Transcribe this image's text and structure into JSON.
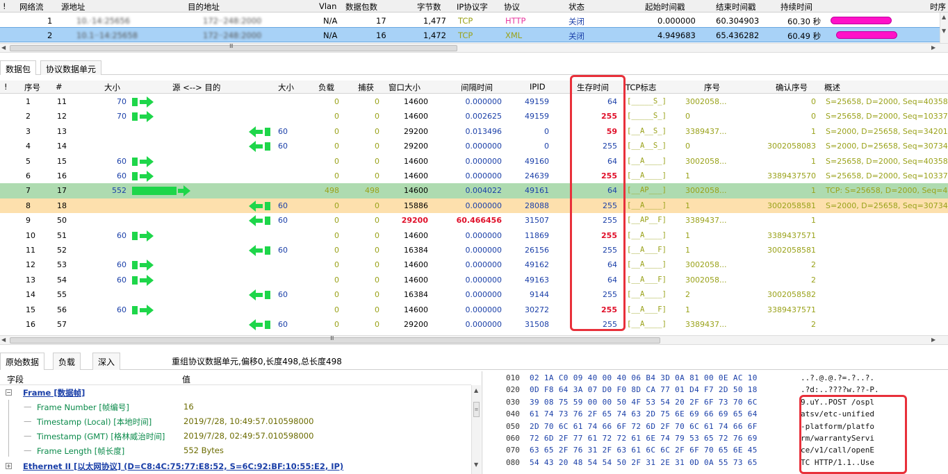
{
  "flows": {
    "columns": [
      "!",
      "网络流",
      "源地址",
      "目的地址",
      "Vlan",
      "数据包数",
      "字节数",
      "IP协议字",
      "协议",
      "状态",
      "起始时间戳",
      "结束时间戳",
      "持续时间",
      "时序"
    ],
    "rows": [
      {
        "idx": "1",
        "src": "10.·14:25656",
        "dst": "172··248:2000",
        "vlan": "N/A",
        "packets": "17",
        "bytes": "1,477",
        "ip_proto": "TCP",
        "proto": "HTTP",
        "state": "关闭",
        "start": "0.000000",
        "end": "60.304903",
        "duration": "60.30 秒"
      },
      {
        "idx": "2",
        "src": "10.1··14:25658",
        "dst": "172··248:2000",
        "vlan": "N/A",
        "packets": "16",
        "bytes": "1,472",
        "ip_proto": "TCP",
        "proto": "XML",
        "state": "关闭",
        "start": "4.949683",
        "end": "65.436282",
        "duration": "60.49 秒"
      }
    ],
    "scroll_grip": "Ⅲ"
  },
  "tabs": {
    "packets": "数据包",
    "pdu": "协议数据单元"
  },
  "packets": {
    "columns": [
      "!",
      "序号",
      "#",
      "大小",
      "源 <--> 目的",
      "大小",
      "负载",
      "捕获",
      "窗口大小",
      "间隔时间",
      "IPID",
      "生存时间",
      "TCP标志",
      "序号",
      "确认序号",
      "概述"
    ],
    "rows": [
      {
        "n": "1",
        "num": "11",
        "dir": "out",
        "size_l": "70",
        "size_r": "",
        "payload": "0",
        "cap": "0",
        "win": "14600",
        "gap": "0.000000",
        "ipid": "49159",
        "ttl": "64",
        "ttl_red": false,
        "flags": "[_____S_]",
        "seq": "3002058...",
        "ack": "0",
        "summary": "S=25658, D=2000, Seq=40358"
      },
      {
        "n": "2",
        "num": "12",
        "dir": "out",
        "size_l": "70",
        "size_r": "",
        "payload": "0",
        "cap": "0",
        "win": "14600",
        "gap": "0.002625",
        "ipid": "49159",
        "ttl": "255",
        "ttl_red": true,
        "flags": "[_____S_]",
        "seq": "0",
        "ack": "0",
        "summary": "S=25658, D=2000, Seq=10337"
      },
      {
        "n": "3",
        "num": "13",
        "dir": "in",
        "size_l": "",
        "size_r": "60",
        "payload": "0",
        "cap": "0",
        "win": "29200",
        "gap": "0.013496",
        "ipid": "0",
        "ttl": "59",
        "ttl_red": true,
        "flags": "[__A__S_]",
        "seq": "3389437...",
        "ack": "1",
        "summary": "S=2000, D=25658, Seq=34201"
      },
      {
        "n": "4",
        "num": "14",
        "dir": "in",
        "size_l": "",
        "size_r": "60",
        "payload": "0",
        "cap": "0",
        "win": "29200",
        "gap": "0.000000",
        "ipid": "0",
        "ttl": "255",
        "ttl_red": false,
        "flags": "[__A__S_]",
        "seq": "0",
        "ack": "3002058083",
        "summary": "S=2000, D=25658, Seq=30734"
      },
      {
        "n": "5",
        "num": "15",
        "dir": "out",
        "size_l": "60",
        "size_r": "",
        "payload": "0",
        "cap": "0",
        "win": "14600",
        "gap": "0.000000",
        "ipid": "49160",
        "ttl": "64",
        "ttl_red": false,
        "flags": "[__A____]",
        "seq": "3002058...",
        "ack": "1",
        "summary": "S=25658, D=2000, Seq=40358"
      },
      {
        "n": "6",
        "num": "16",
        "dir": "out",
        "size_l": "60",
        "size_r": "",
        "payload": "0",
        "cap": "0",
        "win": "14600",
        "gap": "0.000000",
        "ipid": "24639",
        "ttl": "255",
        "ttl_red": true,
        "flags": "[__A____]",
        "seq": "1",
        "ack": "3389437570",
        "summary": "S=25658, D=2000, Seq=10337"
      },
      {
        "n": "7",
        "num": "17",
        "dir": "big",
        "size_l": "552",
        "size_r": "",
        "payload": "498",
        "cap": "498",
        "win": "14600",
        "gap": "0.004022",
        "ipid": "49161",
        "ttl": "64",
        "ttl_red": false,
        "flags": "[__AP___]",
        "seq": "3002058...",
        "ack": "1",
        "summary": "TCP: S=25658, D=2000, Seq=4"
      },
      {
        "n": "8",
        "num": "18",
        "dir": "in",
        "size_l": "",
        "size_r": "60",
        "payload": "0",
        "cap": "0",
        "win": "15886",
        "gap": "0.000000",
        "ipid": "28088",
        "ttl": "255",
        "ttl_red": false,
        "flags": "[__A____]",
        "seq": "1",
        "ack": "3002058581",
        "summary": "S=2000, D=25658, Seq=30734"
      },
      {
        "n": "9",
        "num": "50",
        "dir": "in",
        "size_l": "",
        "size_r": "60",
        "payload": "0",
        "cap": "0",
        "win": "29200",
        "win_red": true,
        "gap": "60.466456",
        "gap_red": true,
        "ipid": "31507",
        "ttl": "255",
        "ttl_red": false,
        "flags": "[__AP__F]",
        "seq": "3389437...",
        "ack": "1",
        "summary": ""
      },
      {
        "n": "10",
        "num": "51",
        "dir": "out",
        "size_l": "60",
        "size_r": "",
        "payload": "0",
        "cap": "0",
        "win": "14600",
        "gap": "0.000000",
        "ipid": "11869",
        "ttl": "255",
        "ttl_red": true,
        "flags": "[__A____]",
        "seq": "1",
        "ack": "3389437571",
        "summary": ""
      },
      {
        "n": "11",
        "num": "52",
        "dir": "in",
        "size_l": "",
        "size_r": "60",
        "payload": "0",
        "cap": "0",
        "win": "16384",
        "gap": "0.000000",
        "ipid": "26156",
        "ttl": "255",
        "ttl_red": false,
        "flags": "[__A___F]",
        "seq": "1",
        "ack": "3002058581",
        "summary": ""
      },
      {
        "n": "12",
        "num": "53",
        "dir": "out",
        "size_l": "60",
        "size_r": "",
        "payload": "0",
        "cap": "0",
        "win": "14600",
        "gap": "0.000000",
        "ipid": "49162",
        "ttl": "64",
        "ttl_red": false,
        "flags": "[__A____]",
        "seq": "3002058...",
        "ack": "2",
        "summary": ""
      },
      {
        "n": "13",
        "num": "54",
        "dir": "out",
        "size_l": "60",
        "size_r": "",
        "payload": "0",
        "cap": "0",
        "win": "14600",
        "gap": "0.000000",
        "ipid": "49163",
        "ttl": "64",
        "ttl_red": false,
        "flags": "[__A___F]",
        "seq": "3002058...",
        "ack": "2",
        "summary": ""
      },
      {
        "n": "14",
        "num": "55",
        "dir": "in",
        "size_l": "",
        "size_r": "60",
        "payload": "0",
        "cap": "0",
        "win": "16384",
        "gap": "0.000000",
        "ipid": "9144",
        "ttl": "255",
        "ttl_red": false,
        "flags": "[__A____]",
        "seq": "2",
        "ack": "3002058582",
        "summary": ""
      },
      {
        "n": "15",
        "num": "56",
        "dir": "out",
        "size_l": "60",
        "size_r": "",
        "payload": "0",
        "cap": "0",
        "win": "14600",
        "gap": "0.000000",
        "ipid": "30272",
        "ttl": "255",
        "ttl_red": true,
        "flags": "[__A___F]",
        "seq": "1",
        "ack": "3389437571",
        "summary": ""
      },
      {
        "n": "16",
        "num": "57",
        "dir": "in",
        "size_l": "",
        "size_r": "60",
        "payload": "0",
        "cap": "0",
        "win": "29200",
        "gap": "0.000000",
        "ipid": "31508",
        "ttl": "255",
        "ttl_red": false,
        "flags": "[__A____]",
        "seq": "3389437...",
        "ack": "2",
        "summary": ""
      }
    ],
    "scroll_grip": "Ⅲ"
  },
  "bottom_tabs": {
    "raw": "原始数据",
    "payload": "负载",
    "deep": "深入"
  },
  "reassembly_text": "重组协议数据单元,偏移0,长度498,总长度498",
  "fields": {
    "col_field": "字段",
    "col_value": "值",
    "frame_title": "Frame [数据帧]",
    "items": [
      {
        "name": "Frame Number [帧编号]",
        "value": "16"
      },
      {
        "name": "Timestamp (Local) [本地时间]",
        "value": "2019/7/28, 10:49:57.010598000"
      },
      {
        "name": "Timestamp (GMT) [格林威治时间]",
        "value": "2019/7/28, 02:49:57.010598000"
      },
      {
        "name": "Frame Length [帧长度]",
        "value": "552 Bytes"
      }
    ],
    "ethernet_title": "Ethernet II [以太网协议] (D=C8:4C:75:77:E8:52, S=6C:92:BF:10:55:E2, IP)"
  },
  "hex": [
    {
      "off": "010",
      "bytes": "02 1A C0 09 40 00 40 06 B4 3D 0A 81 00 0E AC 10",
      "ascii": "..?.@.@.?=.?..?."
    },
    {
      "off": "020",
      "bytes": "0D F8 64 3A 07 D0 F0 8D CA 77 01 D4 F7 2D 50 18",
      "ascii": ".?d:..????w.??-P."
    },
    {
      "off": "030",
      "bytes": "39 08 75 59 00 00 50 4F 53 54 20 2F 6F 73 70 6C",
      "ascii": "9.uY..POST /ospl"
    },
    {
      "off": "040",
      "bytes": "61 74 73 76 2F 65 74 63 2D 75 6E 69 66 69 65 64",
      "ascii": "atsv/etc-unified"
    },
    {
      "off": "050",
      "bytes": "2D 70 6C 61 74 66 6F 72 6D 2F 70 6C 61 74 66 6F",
      "ascii": "-platform/platfo"
    },
    {
      "off": "060",
      "bytes": "72 6D 2F 77 61 72 72 61 6E 74 79 53 65 72 76 69",
      "ascii": "rm/warrantyServi"
    },
    {
      "off": "070",
      "bytes": "63 65 2F 76 31 2F 63 61 6C 6C 2F 6F 70 65 6E 45",
      "ascii": "ce/v1/call/openE"
    },
    {
      "off": "080",
      "bytes": "54 43 20 48 54 54 50 2F 31 2E 31 0D 0A 55 73 65",
      "ascii": "TC HTTP/1.1..Use"
    }
  ],
  "colors": {
    "green_arrow": "#1ed64a",
    "selected_row": "#a8d2f7",
    "duration_bar": "#ff12c8",
    "highlight_box": "#e8303a",
    "green_row": "#aedbb0",
    "orange_row": "#fde0ad"
  }
}
